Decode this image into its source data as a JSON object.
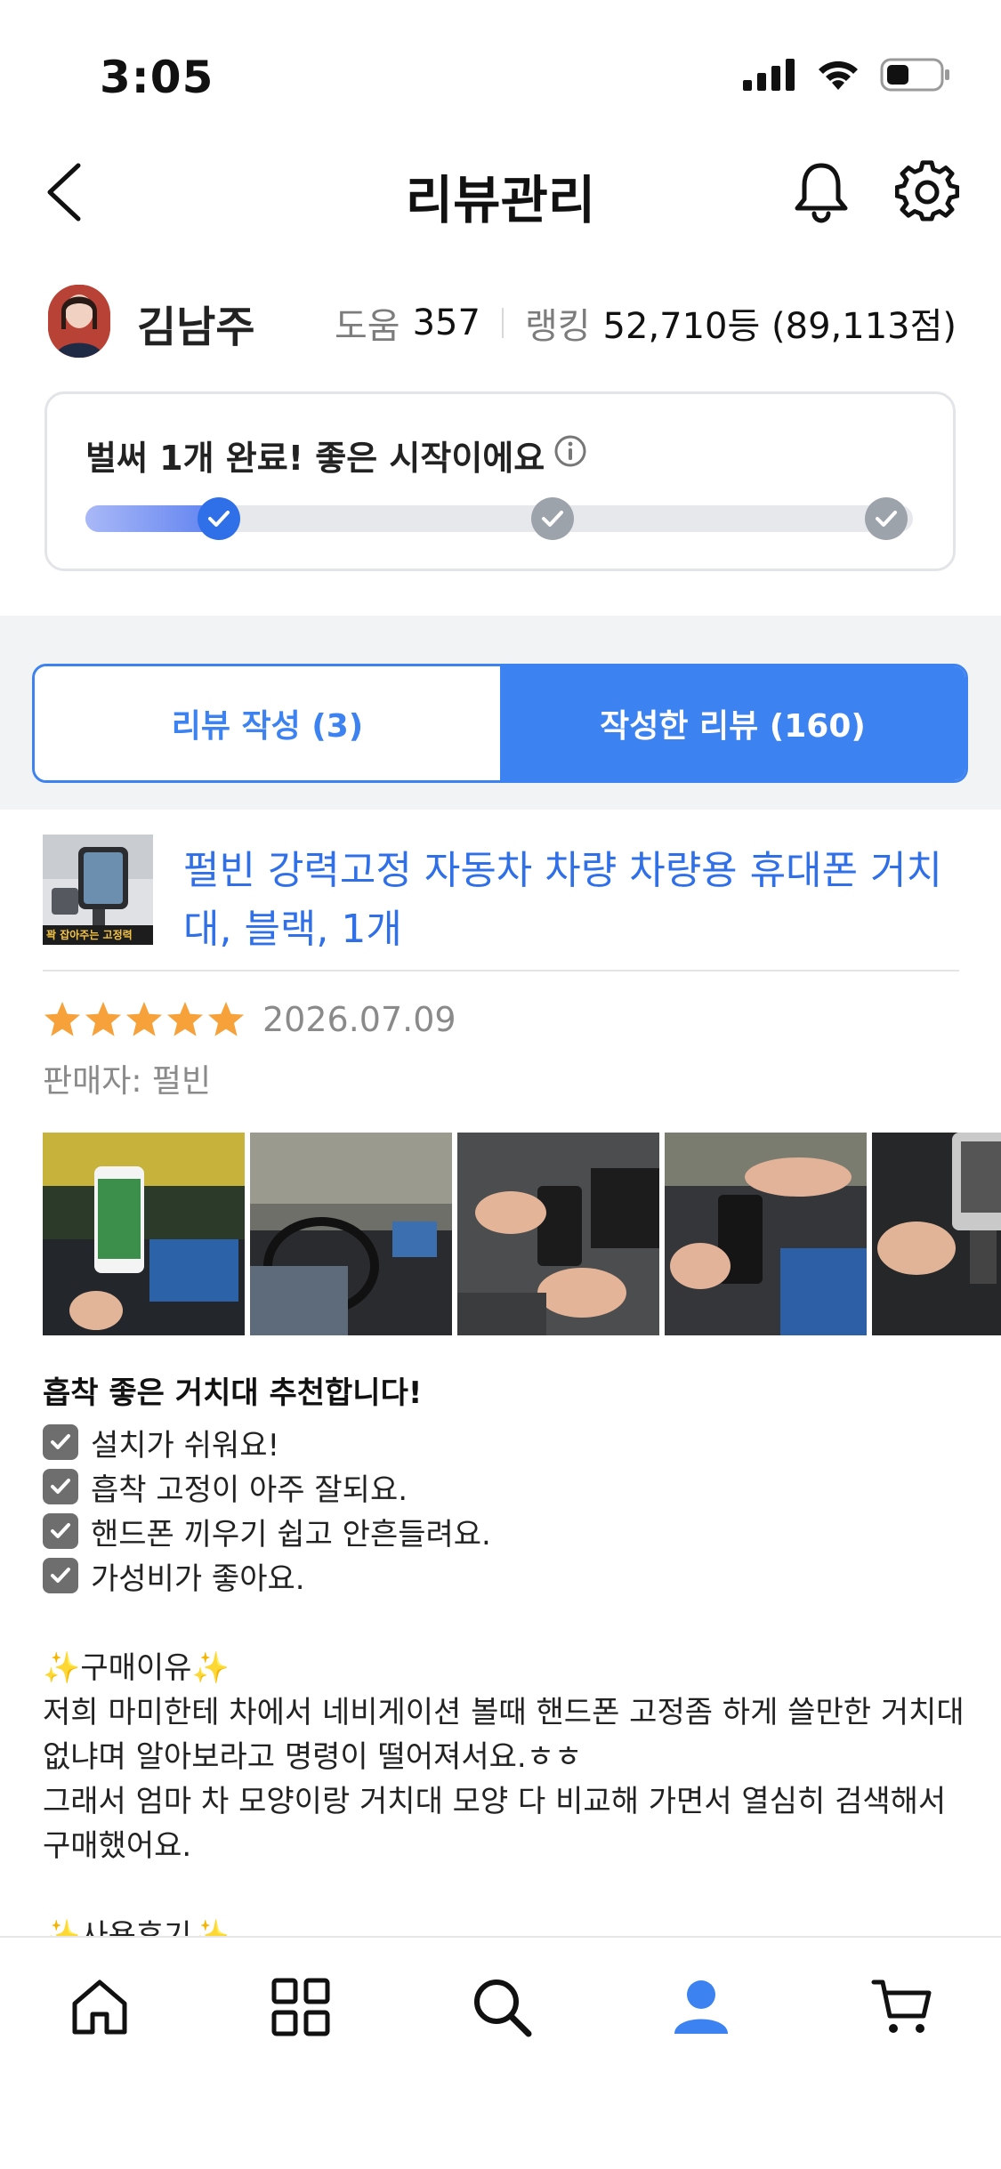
{
  "status_bar": {
    "time": "3:05"
  },
  "nav": {
    "title": "리뷰관리"
  },
  "profile": {
    "name": "김남주",
    "help_label": "도움",
    "help_value": "357",
    "ranking_label": "랭킹",
    "ranking_value": "52,710등 (89,113점)"
  },
  "progress": {
    "message": "벌써 1개 완료! 좋은 시작이에요",
    "completed_steps": 1,
    "total_steps": 3
  },
  "tabs": {
    "write": "리뷰 작성 (3)",
    "written": "작성한 리뷰 (160)"
  },
  "review": {
    "product_title": "펄빈 강력고정 자동차 차량 차량용 휴대폰 거치대, 블랙, 1개",
    "thumb_caption": "꽉 잡아주는 고정력",
    "rating": 5,
    "date": "2026.07.09",
    "seller": "판매자: 펄빈",
    "headline": "흡착 좋은 거치대 추천합니다!",
    "checks": [
      "설치가 쉬워요!",
      "흡착 고정이 아주 잘되요.",
      "핸드폰 끼우기 쉽고 안흔들려요.",
      "가성비가 좋아요."
    ],
    "section1_title": "구매이유",
    "section1_body_1": "저희 마미한테 차에서 네비게이션 볼때 핸드폰 고정좀 하게 쓸만한 거치대 없냐며 알아보라고 명령이 떨어져서요.ㅎㅎ",
    "section1_body_2": "그래서 엄마 차 모양이랑 거치대 모양 다 비교해 가면서 열심히 검색해서 구매했어요.",
    "section2_title": "사용후기"
  },
  "colors": {
    "accent": "#3c82f0",
    "star": "#f6a13a"
  }
}
